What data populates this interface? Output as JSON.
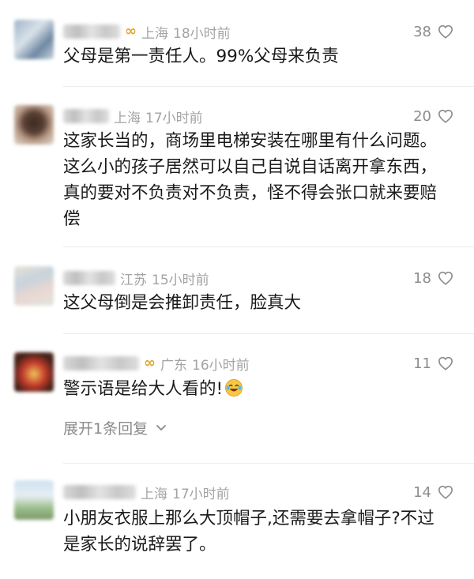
{
  "comments": [
    {
      "location": "上海",
      "time": "18小时前",
      "likes": "38",
      "badge": true,
      "text": "父母是第一责任人。99%父母来负责"
    },
    {
      "location": "上海",
      "time": "17小时前",
      "likes": "20",
      "badge": false,
      "text": "这家长当的，商场里电梯安装在哪里有什么问题。这么小的孩子居然可以自己自说自话离开拿东西，真的要对不负责对不负责，怪不得会张口就来要赔偿"
    },
    {
      "location": "江苏",
      "time": "15小时前",
      "likes": "18",
      "badge": false,
      "text": "这父母倒是会推卸责任，脸真大"
    },
    {
      "location": "广东",
      "time": "16小时前",
      "likes": "11",
      "badge": true,
      "text": "警示语是给大人看的!",
      "emoji": "laughing-tears-emoji",
      "expand_label": "展开1条回复"
    },
    {
      "location": "上海",
      "time": "17小时前",
      "likes": "14",
      "badge": false,
      "text": "小朋友衣服上那么大顶帽子,还需要去拿帽子?不过是家长的说辞罢了。"
    }
  ],
  "icons": {
    "like": "heart-outline-icon",
    "badge": "gold-badge-icon",
    "expand": "chevron-down-icon"
  },
  "colors": {
    "meta": "#a3a3a3",
    "text": "#1a1a1a",
    "badge": "#e3a72f",
    "divider": "#ececec"
  }
}
